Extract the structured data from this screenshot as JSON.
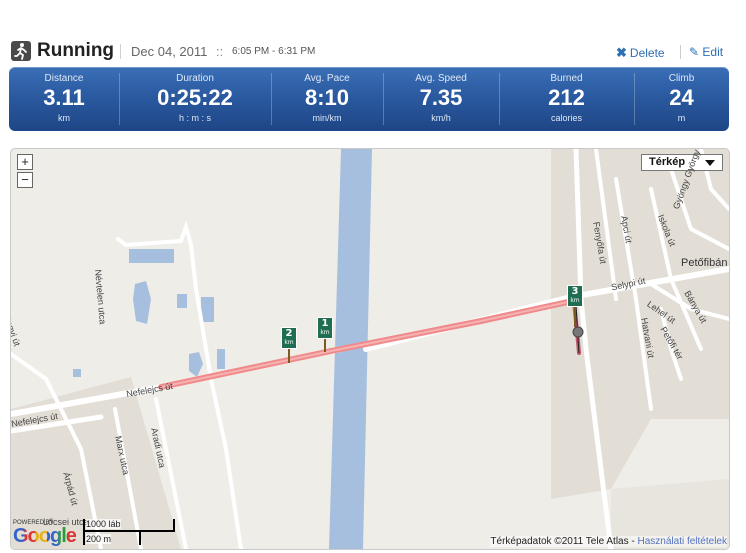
{
  "header": {
    "activity": "Running",
    "date": "Dec 04, 2011",
    "separator": "::",
    "time_range": "6:05 PM - 6:31 PM",
    "delete_label": "Delete",
    "edit_label": "Edit"
  },
  "stats": [
    {
      "label": "Distance",
      "value": "3.11",
      "unit": "km"
    },
    {
      "label": "Duration",
      "value": "0:25:22",
      "unit": "h : m : s"
    },
    {
      "label": "Avg. Pace",
      "value": "8:10",
      "unit": "min/km"
    },
    {
      "label": "Avg. Speed",
      "value": "7.35",
      "unit": "km/h"
    },
    {
      "label": "Burned",
      "value": "212",
      "unit": "calories"
    },
    {
      "label": "Climb",
      "value": "24",
      "unit": "m"
    }
  ],
  "map": {
    "zoom_in": "+",
    "zoom_out": "−",
    "map_type": "Térkép",
    "streets": {
      "nevtelen": "Névtelen utca",
      "nefelejcs1": "Nefelejcs út",
      "nefelejcs2": "Nefelejcs út",
      "nagyi": "Nagyi út",
      "marx": "Marx utca",
      "aradi": "Aradi utca",
      "arpad": "Árpád út",
      "locsei": "Lőcsei utca",
      "selypi": "Selypi út",
      "fenyofa": "Fenyőfa út",
      "apci": "Apci út",
      "iskola": "Iskola út",
      "gyorgy": "Gyöngy György út",
      "lehel": "Lehel út",
      "hatvani": "Hatvani út",
      "petofi": "Petőfi tér",
      "banya": "Bánya út",
      "petofi_place": "Petőfibán"
    },
    "km_markers": [
      {
        "number": "1",
        "unit": "km"
      },
      {
        "number": "2",
        "unit": "km"
      },
      {
        "number": "3",
        "unit": "km"
      }
    ],
    "scale_imperial": "1000 láb",
    "scale_metric": "200 m",
    "powered_by": "POWERED BY",
    "google": "Google",
    "copyright": "Térképadatok ©2011 Tele Atlas -",
    "terms_link": "Használati feltételek",
    "colors": {
      "route": "#f08a8a",
      "water": "#a6bfdf",
      "land": "#efede8",
      "field": "#e2ded6"
    }
  }
}
